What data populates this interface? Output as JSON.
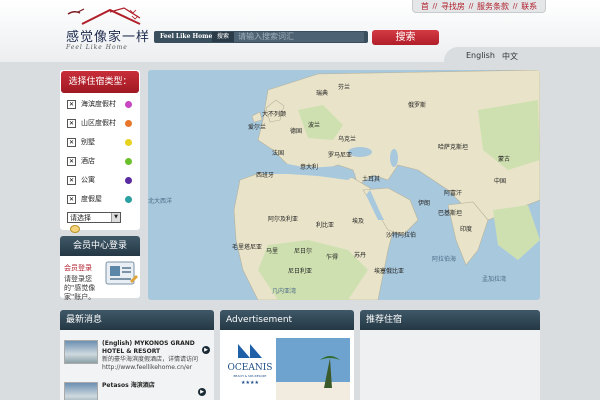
{
  "header": {
    "logo_text": "感觉像家一样",
    "logo_sub": "Feel Like Home",
    "top_nav": [
      "首",
      "寻找房",
      "服务条款",
      "联系"
    ],
    "search_brand": "Feel Like Home",
    "search_tab": "搜索",
    "search_placeholder": "请输入搜索词汇",
    "search_button": "搜索",
    "lang_en": "English",
    "lang_cn": "中文"
  },
  "categories": {
    "title": "选择住宿类型：",
    "items": [
      {
        "label": "海滨度假村",
        "color": "#c946c2"
      },
      {
        "label": "山区度假村",
        "color": "#e8772b"
      },
      {
        "label": "别墅",
        "color": "#e6d21f"
      },
      {
        "label": "酒店",
        "color": "#6bbf2a"
      },
      {
        "label": "公寓",
        "color": "#5a2aa0"
      },
      {
        "label": "度假屋",
        "color": "#2aa0a0"
      }
    ],
    "select_value": "请选择"
  },
  "member": {
    "title": "会员中心登录",
    "link": "会员登录",
    "text": "请登录您的\"感觉像家\"账户。"
  },
  "map": {
    "labels": [
      {
        "text": "大不列颠",
        "type": "land"
      },
      {
        "text": "爱尔兰",
        "type": "land"
      },
      {
        "text": "瑞典",
        "type": "land"
      },
      {
        "text": "芬兰",
        "type": "land"
      },
      {
        "text": "俄罗斯",
        "type": "land"
      },
      {
        "text": "德国",
        "type": "land"
      },
      {
        "text": "波兰",
        "type": "land"
      },
      {
        "text": "乌克兰",
        "type": "land"
      },
      {
        "text": "法国",
        "type": "land"
      },
      {
        "text": "罗马尼亚",
        "type": "land"
      },
      {
        "text": "西班牙",
        "type": "land"
      },
      {
        "text": "意大利",
        "type": "land"
      },
      {
        "text": "土耳其",
        "type": "land"
      },
      {
        "text": "哈萨克斯坦",
        "type": "land"
      },
      {
        "text": "蒙古",
        "type": "land"
      },
      {
        "text": "中国",
        "type": "land"
      },
      {
        "text": "阿尔及利亚",
        "type": "land"
      },
      {
        "text": "利比亚",
        "type": "land"
      },
      {
        "text": "埃及",
        "type": "land"
      },
      {
        "text": "伊朗",
        "type": "land"
      },
      {
        "text": "阿富汗",
        "type": "land"
      },
      {
        "text": "巴基斯坦",
        "type": "land"
      },
      {
        "text": "印度",
        "type": "land"
      },
      {
        "text": "沙特阿拉伯",
        "type": "land"
      },
      {
        "text": "马里",
        "type": "land"
      },
      {
        "text": "尼日尔",
        "type": "land"
      },
      {
        "text": "乍得",
        "type": "land"
      },
      {
        "text": "苏丹",
        "type": "land"
      },
      {
        "text": "毛里塔尼亚",
        "type": "land"
      },
      {
        "text": "尼日利亚",
        "type": "land"
      },
      {
        "text": "埃塞俄比亚",
        "type": "land"
      },
      {
        "text": "北大西洋",
        "type": "water"
      },
      {
        "text": "阿拉伯海",
        "type": "water"
      },
      {
        "text": "孟加拉湾",
        "type": "water"
      },
      {
        "text": "几内亚湾",
        "type": "water"
      }
    ]
  },
  "news": {
    "title": "最新消息",
    "items": [
      {
        "title": "(English) MYKONOS GRAND HOTEL & RESORT",
        "desc": "新的豪华海滨度假酒店，详情请访问 http://www.feellikehome.cn/er"
      },
      {
        "title": "Petasos 海滨酒店",
        "desc": ""
      }
    ]
  },
  "ad": {
    "title": "Advertisement",
    "brand": "OCEANIS",
    "brand_sub": "BEACH & SPA RESORT"
  },
  "right_box": {
    "title": "推荐住宿"
  },
  "colors": {
    "accent_red": "#b01e2a",
    "panel_dark": "#2f4553"
  }
}
